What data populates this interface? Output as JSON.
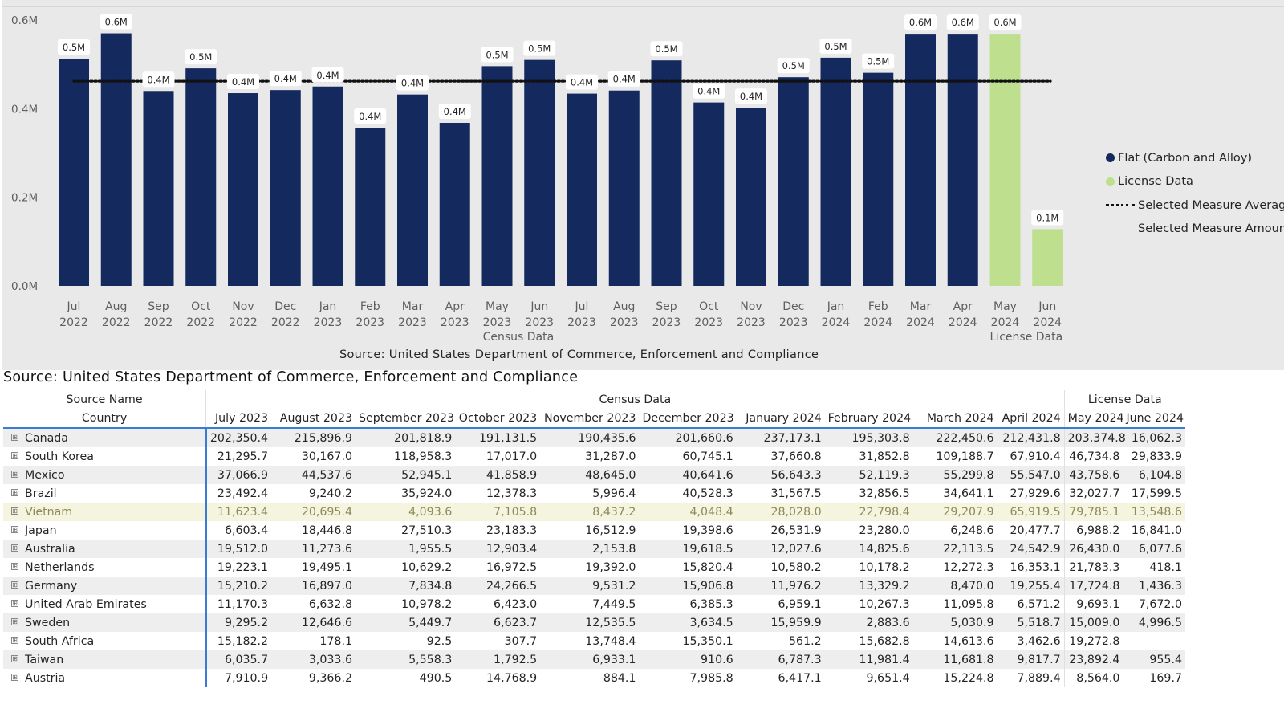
{
  "chart_data": {
    "type": "bar",
    "categories": [
      "Jul 2022",
      "Aug 2022",
      "Sep 2022",
      "Oct 2022",
      "Nov 2022",
      "Dec 2022",
      "Jan 2023",
      "Feb 2023",
      "Mar 2023",
      "Apr 2023",
      "May 2023",
      "Jun 2023",
      "Jul 2023",
      "Aug 2023",
      "Sep 2023",
      "Oct 2023",
      "Nov 2023",
      "Dec 2023",
      "Jan 2024",
      "Feb 2024",
      "Mar 2024",
      "Apr 2024",
      "May 2024",
      "Jun 2024"
    ],
    "x_months": [
      "Jul",
      "Aug",
      "Sep",
      "Oct",
      "Nov",
      "Dec",
      "Jan",
      "Feb",
      "Mar",
      "Apr",
      "May",
      "Jun",
      "Jul",
      "Aug",
      "Sep",
      "Oct",
      "Nov",
      "Dec",
      "Jan",
      "Feb",
      "Mar",
      "Apr",
      "May",
      "Jun"
    ],
    "x_years": [
      "2022",
      "2022",
      "2022",
      "2022",
      "2022",
      "2022",
      "2023",
      "2023",
      "2023",
      "2023",
      "2023",
      "2023",
      "2023",
      "2023",
      "2023",
      "2023",
      "2023",
      "2023",
      "2024",
      "2024",
      "2024",
      "2024",
      "2024",
      "2024"
    ],
    "values": [
      0.513,
      0.57,
      0.44,
      0.491,
      0.435,
      0.442,
      0.45,
      0.357,
      0.432,
      0.368,
      0.496,
      0.51,
      0.434,
      0.441,
      0.509,
      0.414,
      0.402,
      0.471,
      0.515,
      0.481,
      0.569,
      0.569,
      0.569,
      0.128
    ],
    "data_labels": [
      "0.5M",
      "0.6M",
      "0.4M",
      "0.5M",
      "0.4M",
      "0.4M",
      "0.4M",
      "0.4M",
      "0.4M",
      "0.4M",
      "0.5M",
      "0.5M",
      "0.4M",
      "0.4M",
      "0.5M",
      "0.4M",
      "0.4M",
      "0.5M",
      "0.5M",
      "0.5M",
      "0.6M",
      "0.6M",
      "0.6M",
      "0.1M"
    ],
    "bar_groups": [
      "census",
      "census",
      "census",
      "census",
      "census",
      "census",
      "census",
      "census",
      "census",
      "census",
      "census",
      "census",
      "census",
      "census",
      "census",
      "census",
      "census",
      "census",
      "census",
      "census",
      "census",
      "census",
      "license",
      "license"
    ],
    "average": 0.462,
    "ylim": [
      0,
      0.6
    ],
    "y_ticks": [
      0,
      0.2,
      0.4,
      0.6
    ],
    "y_tick_labels": [
      "0.0M",
      "0.2M",
      "0.4M",
      "0.6M"
    ],
    "group_labels": {
      "census": "Census Data",
      "license": "License Data"
    },
    "colors": {
      "census": "#14295e",
      "license": "#bedf8e",
      "average": "#111111"
    },
    "grid": false,
    "legend_position": "right",
    "legend": {
      "flat": "Flat (Carbon and Alloy)",
      "license": "License Data",
      "average": "Selected Measure Average",
      "amount": "Selected Measure Amount"
    },
    "source": "Source: United States Department of Commerce, Enforcement and Compliance"
  },
  "table": {
    "title": "Source: United States Department of Commerce, Enforcement and Compliance",
    "source_name_header": "Source Name",
    "country_header": "Country",
    "census_group": "Census Data",
    "license_group": "License Data",
    "columns": [
      "July 2023",
      "August 2023",
      "September 2023",
      "October 2023",
      "November 2023",
      "December 2023",
      "January 2024",
      "February 2024",
      "March 2024",
      "April 2024",
      "May 2024",
      "June 2024"
    ],
    "expand_icon": "⊞",
    "highlight_color": "#f4f4df",
    "rows": [
      {
        "country": "Canada",
        "values": [
          "202,350.4",
          "215,896.9",
          "201,818.9",
          "191,131.5",
          "190,435.6",
          "201,660.6",
          "237,173.1",
          "195,303.8",
          "222,450.6",
          "212,431.8",
          "203,374.8",
          "16,062.3"
        ]
      },
      {
        "country": "South Korea",
        "values": [
          "21,295.7",
          "30,167.0",
          "118,958.3",
          "17,017.0",
          "31,287.0",
          "60,745.1",
          "37,660.8",
          "31,852.8",
          "109,188.7",
          "67,910.4",
          "46,734.8",
          "29,833.9"
        ]
      },
      {
        "country": "Mexico",
        "values": [
          "37,066.9",
          "44,537.6",
          "52,945.1",
          "41,858.9",
          "48,645.0",
          "40,641.6",
          "56,643.3",
          "52,119.3",
          "55,299.8",
          "55,547.0",
          "43,758.6",
          "6,104.8"
        ]
      },
      {
        "country": "Brazil",
        "values": [
          "23,492.4",
          "9,240.2",
          "35,924.0",
          "12,378.3",
          "5,996.4",
          "40,528.3",
          "31,567.5",
          "32,856.5",
          "34,641.1",
          "27,929.6",
          "32,027.7",
          "17,599.5"
        ]
      },
      {
        "country": "Vietnam",
        "values": [
          "11,623.4",
          "20,695.4",
          "4,093.6",
          "7,105.8",
          "8,437.2",
          "4,048.4",
          "28,028.0",
          "22,798.4",
          "29,207.9",
          "65,919.5",
          "79,785.1",
          "13,548.6"
        ]
      },
      {
        "country": "Japan",
        "values": [
          "6,603.4",
          "18,446.8",
          "27,510.3",
          "23,183.3",
          "16,512.9",
          "19,398.6",
          "26,531.9",
          "23,280.0",
          "6,248.6",
          "20,477.7",
          "6,988.2",
          "16,841.0"
        ]
      },
      {
        "country": "Australia",
        "values": [
          "19,512.0",
          "11,273.6",
          "1,955.5",
          "12,903.4",
          "2,153.8",
          "19,618.5",
          "12,027.6",
          "14,825.6",
          "22,113.5",
          "24,542.9",
          "26,430.0",
          "6,077.6"
        ]
      },
      {
        "country": "Netherlands",
        "values": [
          "19,223.1",
          "19,495.1",
          "10,629.2",
          "16,972.5",
          "19,392.0",
          "15,820.4",
          "10,580.2",
          "10,178.2",
          "12,272.3",
          "16,353.1",
          "21,783.3",
          "418.1"
        ]
      },
      {
        "country": "Germany",
        "values": [
          "15,210.2",
          "16,897.0",
          "7,834.8",
          "24,266.5",
          "9,531.2",
          "15,906.8",
          "11,976.2",
          "13,329.2",
          "8,470.0",
          "19,255.4",
          "17,724.8",
          "1,436.3"
        ]
      },
      {
        "country": "United Arab Emirates",
        "values": [
          "11,170.3",
          "6,632.8",
          "10,978.2",
          "6,423.0",
          "7,449.5",
          "6,385.3",
          "6,959.1",
          "10,267.3",
          "11,095.8",
          "6,571.2",
          "9,693.1",
          "7,672.0"
        ]
      },
      {
        "country": "Sweden",
        "values": [
          "9,295.2",
          "12,646.6",
          "5,449.7",
          "6,623.7",
          "12,535.5",
          "3,634.5",
          "15,959.9",
          "2,883.6",
          "5,030.9",
          "5,518.7",
          "15,009.0",
          "4,996.5"
        ]
      },
      {
        "country": "South Africa",
        "values": [
          "15,182.2",
          "178.1",
          "92.5",
          "307.7",
          "13,748.4",
          "15,350.1",
          "561.2",
          "15,682.8",
          "14,613.6",
          "3,462.6",
          "19,272.8",
          ""
        ]
      },
      {
        "country": "Taiwan",
        "values": [
          "6,035.7",
          "3,033.6",
          "5,558.3",
          "1,792.5",
          "6,933.1",
          "910.6",
          "6,787.3",
          "11,981.4",
          "11,681.8",
          "9,817.7",
          "23,892.4",
          "955.4"
        ]
      },
      {
        "country": "Austria",
        "values": [
          "7,910.9",
          "9,366.2",
          "490.5",
          "14,768.9",
          "884.1",
          "7,985.8",
          "6,417.1",
          "9,651.4",
          "15,224.8",
          "7,889.4",
          "8,564.0",
          "169.7"
        ]
      }
    ],
    "highlight_row": "Vietnam"
  }
}
